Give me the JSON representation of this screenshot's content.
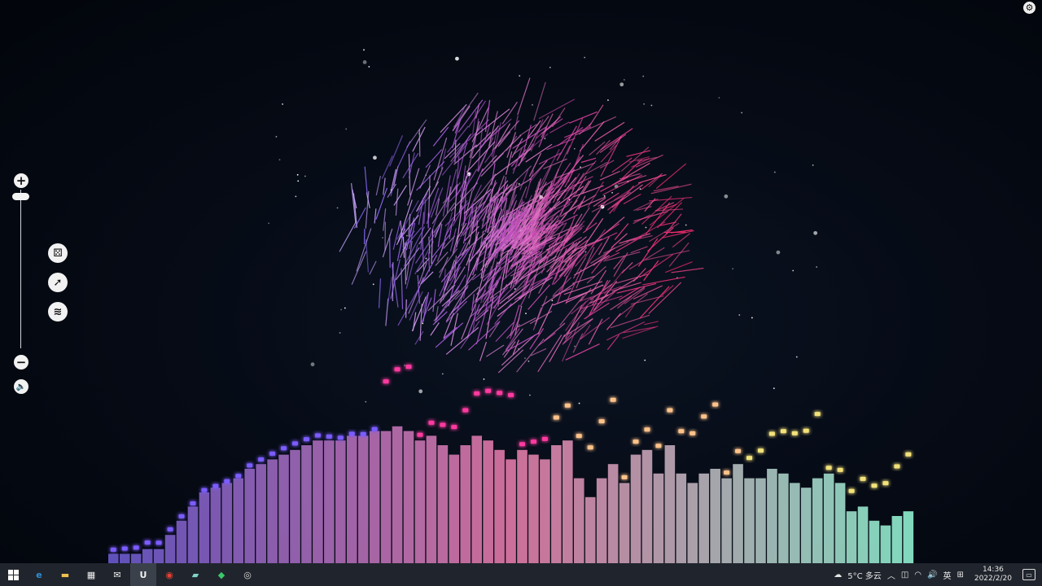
{
  "visualizer": {
    "colors": {
      "start": "#6a5acd",
      "mid": "#e27aa8",
      "end": "#8ff0d0",
      "cloud_a": "#ff2a6a",
      "cloud_b": "#8c6cff"
    },
    "bars": [
      2,
      2,
      2,
      3,
      3,
      6,
      9,
      12,
      15,
      16,
      17,
      18,
      20,
      21,
      22,
      23,
      24,
      25,
      26,
      26,
      26,
      27,
      27,
      28,
      28,
      29,
      28,
      26,
      27,
      25,
      23,
      25,
      27,
      26,
      24,
      22,
      24,
      23,
      22,
      25,
      26,
      18,
      14,
      18,
      21,
      17,
      23,
      24,
      19,
      25,
      19,
      17,
      19,
      20,
      18,
      21,
      18,
      18,
      20,
      19,
      17,
      16,
      18,
      19,
      17,
      11,
      12,
      9,
      8,
      10,
      11
    ]
  },
  "controls": {
    "zoom_in": "+",
    "zoom_out": "−",
    "volume_icon": "🔈",
    "settings_icon": "⚙",
    "modes": [
      "⚄",
      "➚",
      "≋"
    ]
  },
  "taskbar": {
    "apps": [
      {
        "name": "edge",
        "glyph": "e",
        "color": "#2f8ed8"
      },
      {
        "name": "file-explorer",
        "glyph": "▬",
        "color": "#f1c04e"
      },
      {
        "name": "store",
        "glyph": "▦",
        "color": "#f0f0f0"
      },
      {
        "name": "mail",
        "glyph": "✉",
        "color": "#f0f0f0"
      },
      {
        "name": "unreal",
        "glyph": "U",
        "color": "#f0f0f0"
      },
      {
        "name": "chrome",
        "glyph": "◉",
        "color": "#e34133"
      },
      {
        "name": "app-1",
        "glyph": "▰",
        "color": "#7fd3c8"
      },
      {
        "name": "app-2",
        "glyph": "◆",
        "color": "#3cc76b"
      },
      {
        "name": "obs",
        "glyph": "◎",
        "color": "#d9d9d9"
      }
    ],
    "weather": "5°C 多云",
    "ime": "英",
    "time": "14:36",
    "date": "2022/2/20"
  }
}
